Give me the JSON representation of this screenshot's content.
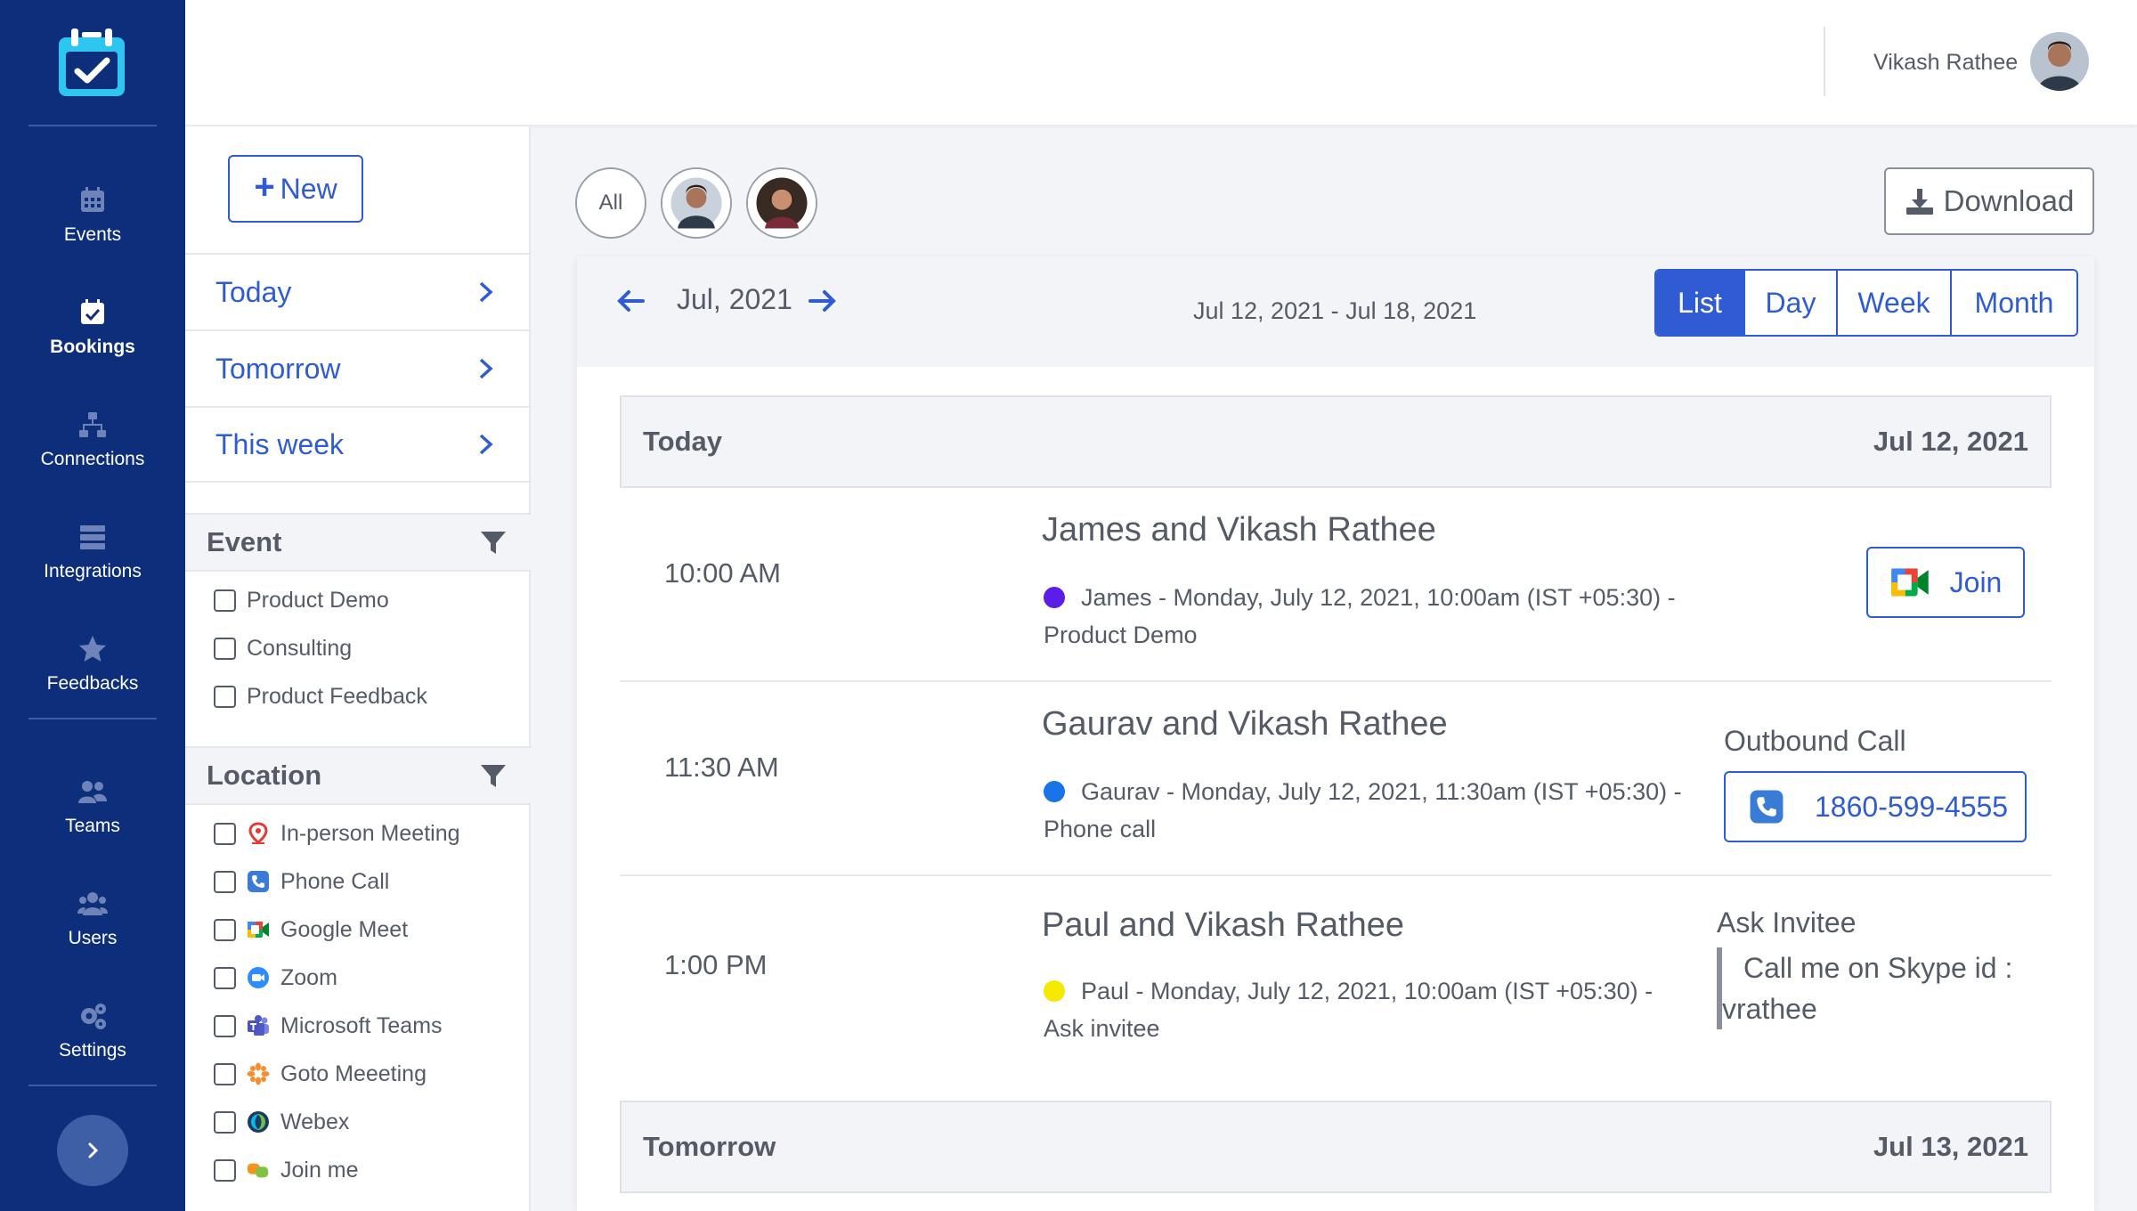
{
  "nav": {
    "items": [
      {
        "label": "Events",
        "icon": "calendar-icon"
      },
      {
        "label": "Bookings",
        "icon": "calendar-check-icon",
        "active": true
      },
      {
        "label": "Connections",
        "icon": "sitemap-icon"
      },
      {
        "label": "Integrations",
        "icon": "server-icon"
      },
      {
        "label": "Feedbacks",
        "icon": "star-icon"
      },
      {
        "label": "Teams",
        "icon": "team-icon"
      },
      {
        "label": "Users",
        "icon": "users-icon"
      },
      {
        "label": "Settings",
        "icon": "gears-icon"
      }
    ]
  },
  "header": {
    "user_name": "Vikash Rathee"
  },
  "filters": {
    "new_label": "New",
    "quick": [
      {
        "label": "Today"
      },
      {
        "label": "Tomorrow"
      },
      {
        "label": "This week"
      }
    ],
    "event_title": "Event",
    "event_types": [
      "Product Demo",
      "Consulting",
      "Product Feedback"
    ],
    "location_title": "Location",
    "locations": [
      {
        "label": "In-person Meeting",
        "icon": "map-pin-icon"
      },
      {
        "label": "Phone Call",
        "icon": "phone-icon"
      },
      {
        "label": "Google Meet",
        "icon": "google-meet-icon"
      },
      {
        "label": "Zoom",
        "icon": "zoom-icon"
      },
      {
        "label": "Microsoft Teams",
        "icon": "microsoft-teams-icon"
      },
      {
        "label": "Goto Meeeting",
        "icon": "gotomeeting-icon"
      },
      {
        "label": "Webex",
        "icon": "webex-icon"
      },
      {
        "label": "Join me",
        "icon": "joinme-icon"
      }
    ]
  },
  "toolbar": {
    "all_label": "All",
    "download_label": "Download"
  },
  "calendar": {
    "month_label": "Jul, 2021",
    "range_label": "Jul 12, 2021 - Jul 18, 2021",
    "views": [
      "List",
      "Day",
      "Week",
      "Month"
    ],
    "active_view": "List"
  },
  "days": [
    {
      "label": "Today",
      "date": "Jul 12, 2021",
      "events": [
        {
          "time": "10:00 AM",
          "title": "James and Vikash Rathee",
          "desc_line1": "James - Monday, July 12, 2021, 10:00am (IST +05:30) -",
          "desc_line2": "Product Demo",
          "dot_color": "#5b1ee8",
          "action_label": "Join"
        },
        {
          "time": "11:30 AM",
          "title": "Gaurav and Vikash Rathee",
          "desc_line1": "Gaurav - Monday, July 12, 2021, 11:30am (IST +05:30) -",
          "desc_line2": "Phone call",
          "dot_color": "#1a73e8",
          "call_label": "Outbound Call",
          "phone": "1860-599-4555"
        },
        {
          "time": "1:00 PM",
          "title": "Paul and Vikash Rathee",
          "desc_line1": "Paul - Monday, July 12, 2021, 10:00am (IST +05:30) -",
          "desc_line2": "Ask invitee",
          "dot_color": "#f5e900",
          "ask_label": "Ask Invitee",
          "ask_line1": "Call me on Skype id :",
          "ask_line2": "vrathee"
        }
      ]
    },
    {
      "label": "Tomorrow",
      "date": "Jul 13, 2021",
      "events": []
    }
  ],
  "colors": {
    "nav_bg": "#0d2e7a",
    "accent": "#2f5bd3",
    "text": "#555b66",
    "panel_bg": "#f3f4f8"
  }
}
